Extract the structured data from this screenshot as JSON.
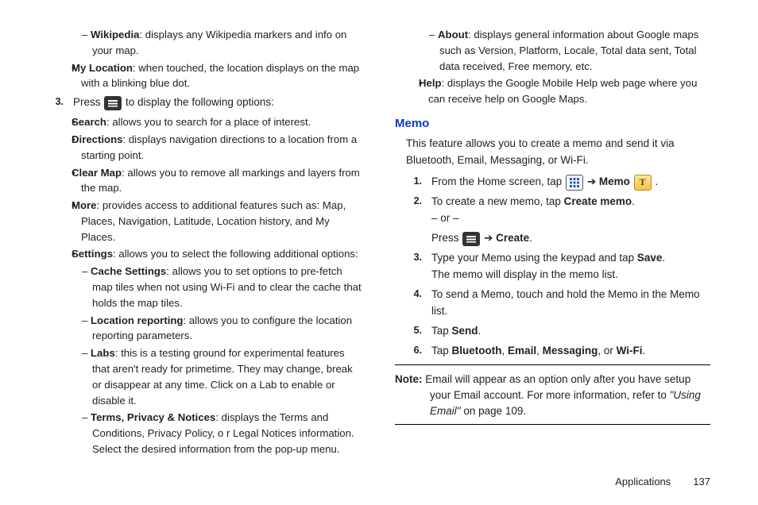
{
  "left": {
    "wikipedia": {
      "term": "Wikipedia",
      "desc": ": displays any Wikipedia markers and info on your map."
    },
    "myloc": {
      "term": "My Location",
      "desc": ": when touched, the location displays on the map with a blinking blue dot."
    },
    "step3": {
      "num": "3.",
      "before": "Press ",
      "after": " to display the following options:"
    },
    "search": {
      "term": "Search",
      "desc": ": allows you to search for a place of interest."
    },
    "directions": {
      "term": "Directions",
      "desc": ": displays navigation directions to a location from a starting point."
    },
    "clearmap": {
      "term": "Clear Map",
      "desc": ": allows you to remove all markings and layers from the map."
    },
    "more": {
      "term": "More",
      "desc": ": provides access to additional features such as: Map, Places, Navigation, Latitude, Location history, and My Places."
    },
    "settings": {
      "term": "Settings",
      "desc": ": allows you to select the following additional options:"
    },
    "cache": {
      "term": "Cache Settings",
      "desc": ": allows you to set options to pre-fetch map tiles when not using Wi-Fi and to clear the cache that holds the map tiles."
    },
    "locrep": {
      "term": "Location reporting",
      "desc": ": allows you to configure the location reporting parameters."
    },
    "labs": {
      "term": "Labs",
      "desc": ": this is a testing ground for experimental features that aren't ready for primetime. They may change, break or disappear at any time. Click on a Lab to enable or disable it."
    },
    "terms": {
      "term": "Terms, Privacy & Notices",
      "desc": ": displays the Terms and Conditions, Privacy Policy, o r Legal Notices information. Select the desired information from the pop-up menu."
    }
  },
  "right": {
    "about": {
      "term": "About",
      "desc": ": displays general information about Google maps such as Version, Platform, Locale, Total data sent, Total data received, Free memory, etc."
    },
    "help": {
      "term": "Help",
      "desc": ": displays the Google Mobile Help web page where you can receive help on Google Maps."
    },
    "heading": "Memo",
    "intro": "This feature allows you to create a memo and send it via Bluetooth, Email, Messaging, or Wi-Fi.",
    "s1": {
      "num": "1.",
      "before": "From the Home screen, tap ",
      "arrow": " ➔ ",
      "memo_label": "Memo",
      "after": " ."
    },
    "s2": {
      "num": "2.",
      "line1a": "To create a new memo, tap ",
      "line1b": "Create memo",
      "line1c": ".",
      "or": "– or –",
      "line2a": "Press ",
      "arrow": " ➔ ",
      "line2b": "Create",
      "line2c": "."
    },
    "s3": {
      "num": "3.",
      "l1a": "Type your Memo using the keypad and tap ",
      "l1b": "Save",
      "l1c": ".",
      "l2": "The memo will display in the memo list."
    },
    "s4": {
      "num": "4.",
      "t": "To send a Memo, touch and hold the Memo in the Memo list."
    },
    "s5": {
      "num": "5.",
      "a": "Tap ",
      "b": "Send",
      "c": "."
    },
    "s6": {
      "num": "6.",
      "a": "Tap ",
      "b1": "Bluetooth",
      "b2": "Email",
      "b3": "Messaging",
      "b4": "Wi-Fi",
      "c1": ", ",
      "c2": ", ",
      "c3": ", or ",
      "c4": "."
    },
    "note": {
      "label": "Note:",
      "body1": " Email will appear as an option only after you have setup your Email account. For more information, refer to ",
      "ref": "\"Using Email\"",
      "body2": " on page 109."
    }
  },
  "footer": {
    "section": "Applications",
    "page": "137"
  }
}
